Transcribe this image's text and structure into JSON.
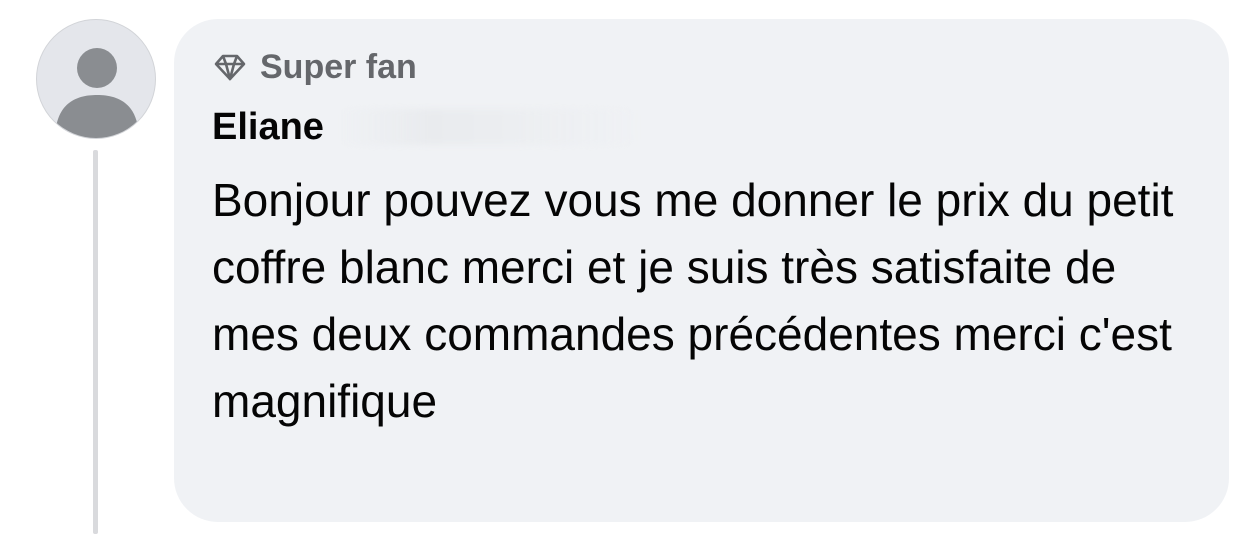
{
  "comment": {
    "badge": {
      "icon": "diamond-icon",
      "label": "Super fan"
    },
    "author": {
      "first_name": "Eliane",
      "surname_redacted": ""
    },
    "text": "Bonjour pouvez vous me donner le prix du petit coffre blanc merci et je suis très satisfaite de mes deux commandes précédentes merci c'est magnifique",
    "avatar": {
      "icon": "default-user-avatar-icon"
    }
  },
  "colors": {
    "bubble_background": "#f0f2f5",
    "badge_text": "#65676b",
    "primary_text": "#050505",
    "thread_line": "#d9dadd",
    "avatar_background": "#e4e6eb",
    "avatar_silhouette": "#8a8d91"
  }
}
